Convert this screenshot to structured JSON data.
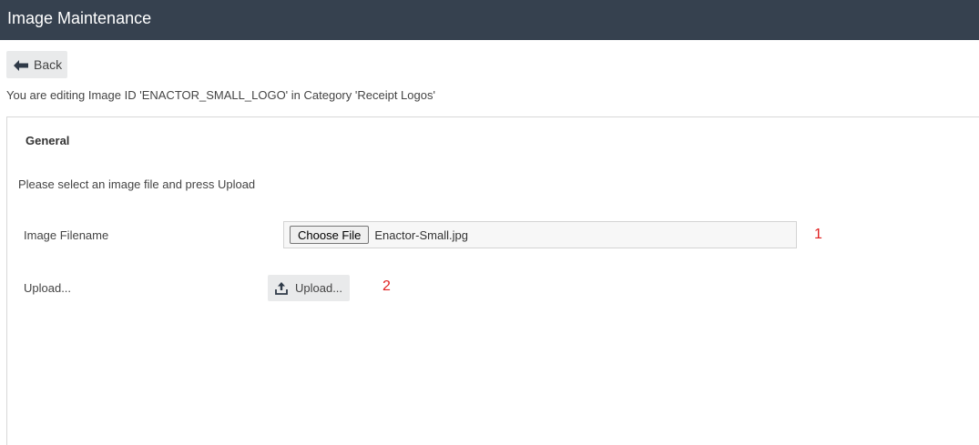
{
  "header": {
    "title": "Image Maintenance"
  },
  "toolbar": {
    "back_label": "Back",
    "back_icon": "arrow-left-icon"
  },
  "editing_info": "You are editing Image ID 'ENACTOR_SMALL_LOGO' in Category 'Receipt Logos'",
  "general_section": {
    "title": "General",
    "instruction": "Please select an image file and press Upload",
    "image_filename": {
      "label": "Image Filename",
      "choose_button_label": "Choose File",
      "selected_file": "Enactor-Small.jpg",
      "marker": "1"
    },
    "upload": {
      "label": "Upload...",
      "button_label": "Upload...",
      "button_icon": "upload-icon",
      "marker": "2"
    }
  },
  "colors": {
    "header_bg": "#36414f",
    "button_bg": "#e9eaeb",
    "marker": "#e02020"
  }
}
